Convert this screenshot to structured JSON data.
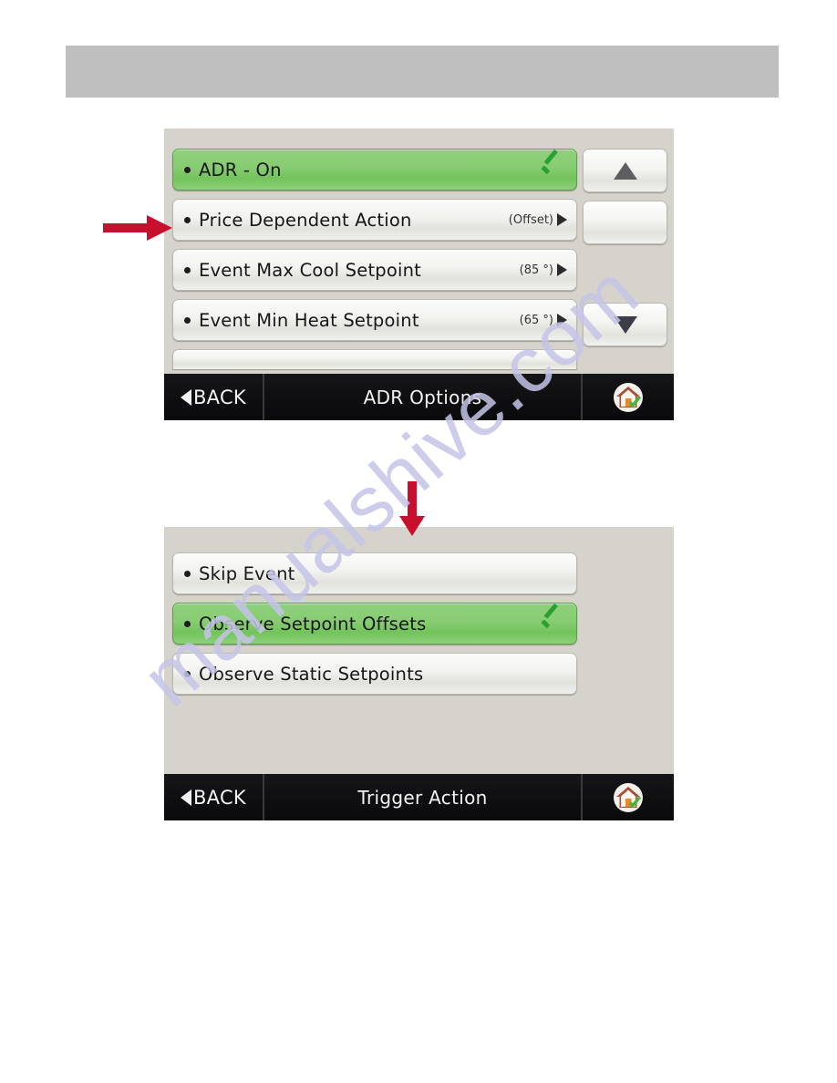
{
  "page": {
    "header_bar": "",
    "watermark": "manualshive.com",
    "watermark_color": "#c5c4e8"
  },
  "colors": {
    "selected_green": "#87cc72",
    "check_green": "#2aa033",
    "screen_background": "#d6d3cc",
    "row_background": "#f3f3f0",
    "bottom_bar": "#0f0f11",
    "annotation_red": "#c8102e"
  },
  "annotations": [
    {
      "name": "arrow-right-price-dependent-action",
      "direction": "right"
    },
    {
      "name": "arrow-down-trigger-action",
      "direction": "down"
    }
  ],
  "screens": [
    {
      "id": "adr-options",
      "rows": [
        {
          "label": "ADR - On",
          "value": "",
          "selected": true,
          "checked": true,
          "chevron": false
        },
        {
          "label": "Price Dependent Action",
          "value": "(Offset)",
          "selected": false,
          "checked": false,
          "chevron": true
        },
        {
          "label": "Event Max Cool Setpoint",
          "value": "(85 °)",
          "selected": false,
          "checked": false,
          "chevron": true
        },
        {
          "label": "Event Min Heat Setpoint",
          "value": "(65 °)",
          "selected": false,
          "checked": false,
          "chevron": true
        }
      ],
      "has_partial_row": true,
      "scroll": {
        "up_icon": "triangle-up-icon",
        "down_icon": "triangle-down-icon",
        "blank_button": ""
      },
      "bottom_bar": {
        "back_label": "BACK",
        "title": "ADR Options",
        "home_icon": "home-icon"
      }
    },
    {
      "id": "trigger-action",
      "rows": [
        {
          "label": "Skip Event",
          "value": "",
          "selected": false,
          "checked": false,
          "chevron": false
        },
        {
          "label": "Observe Setpoint Offsets",
          "value": "",
          "selected": true,
          "checked": true,
          "chevron": false
        },
        {
          "label": "Observe Static Setpoints",
          "value": "",
          "selected": false,
          "checked": false,
          "chevron": false
        }
      ],
      "has_partial_row": false,
      "bottom_bar": {
        "back_label": "BACK",
        "title": "Trigger Action",
        "home_icon": "home-icon"
      }
    }
  ]
}
